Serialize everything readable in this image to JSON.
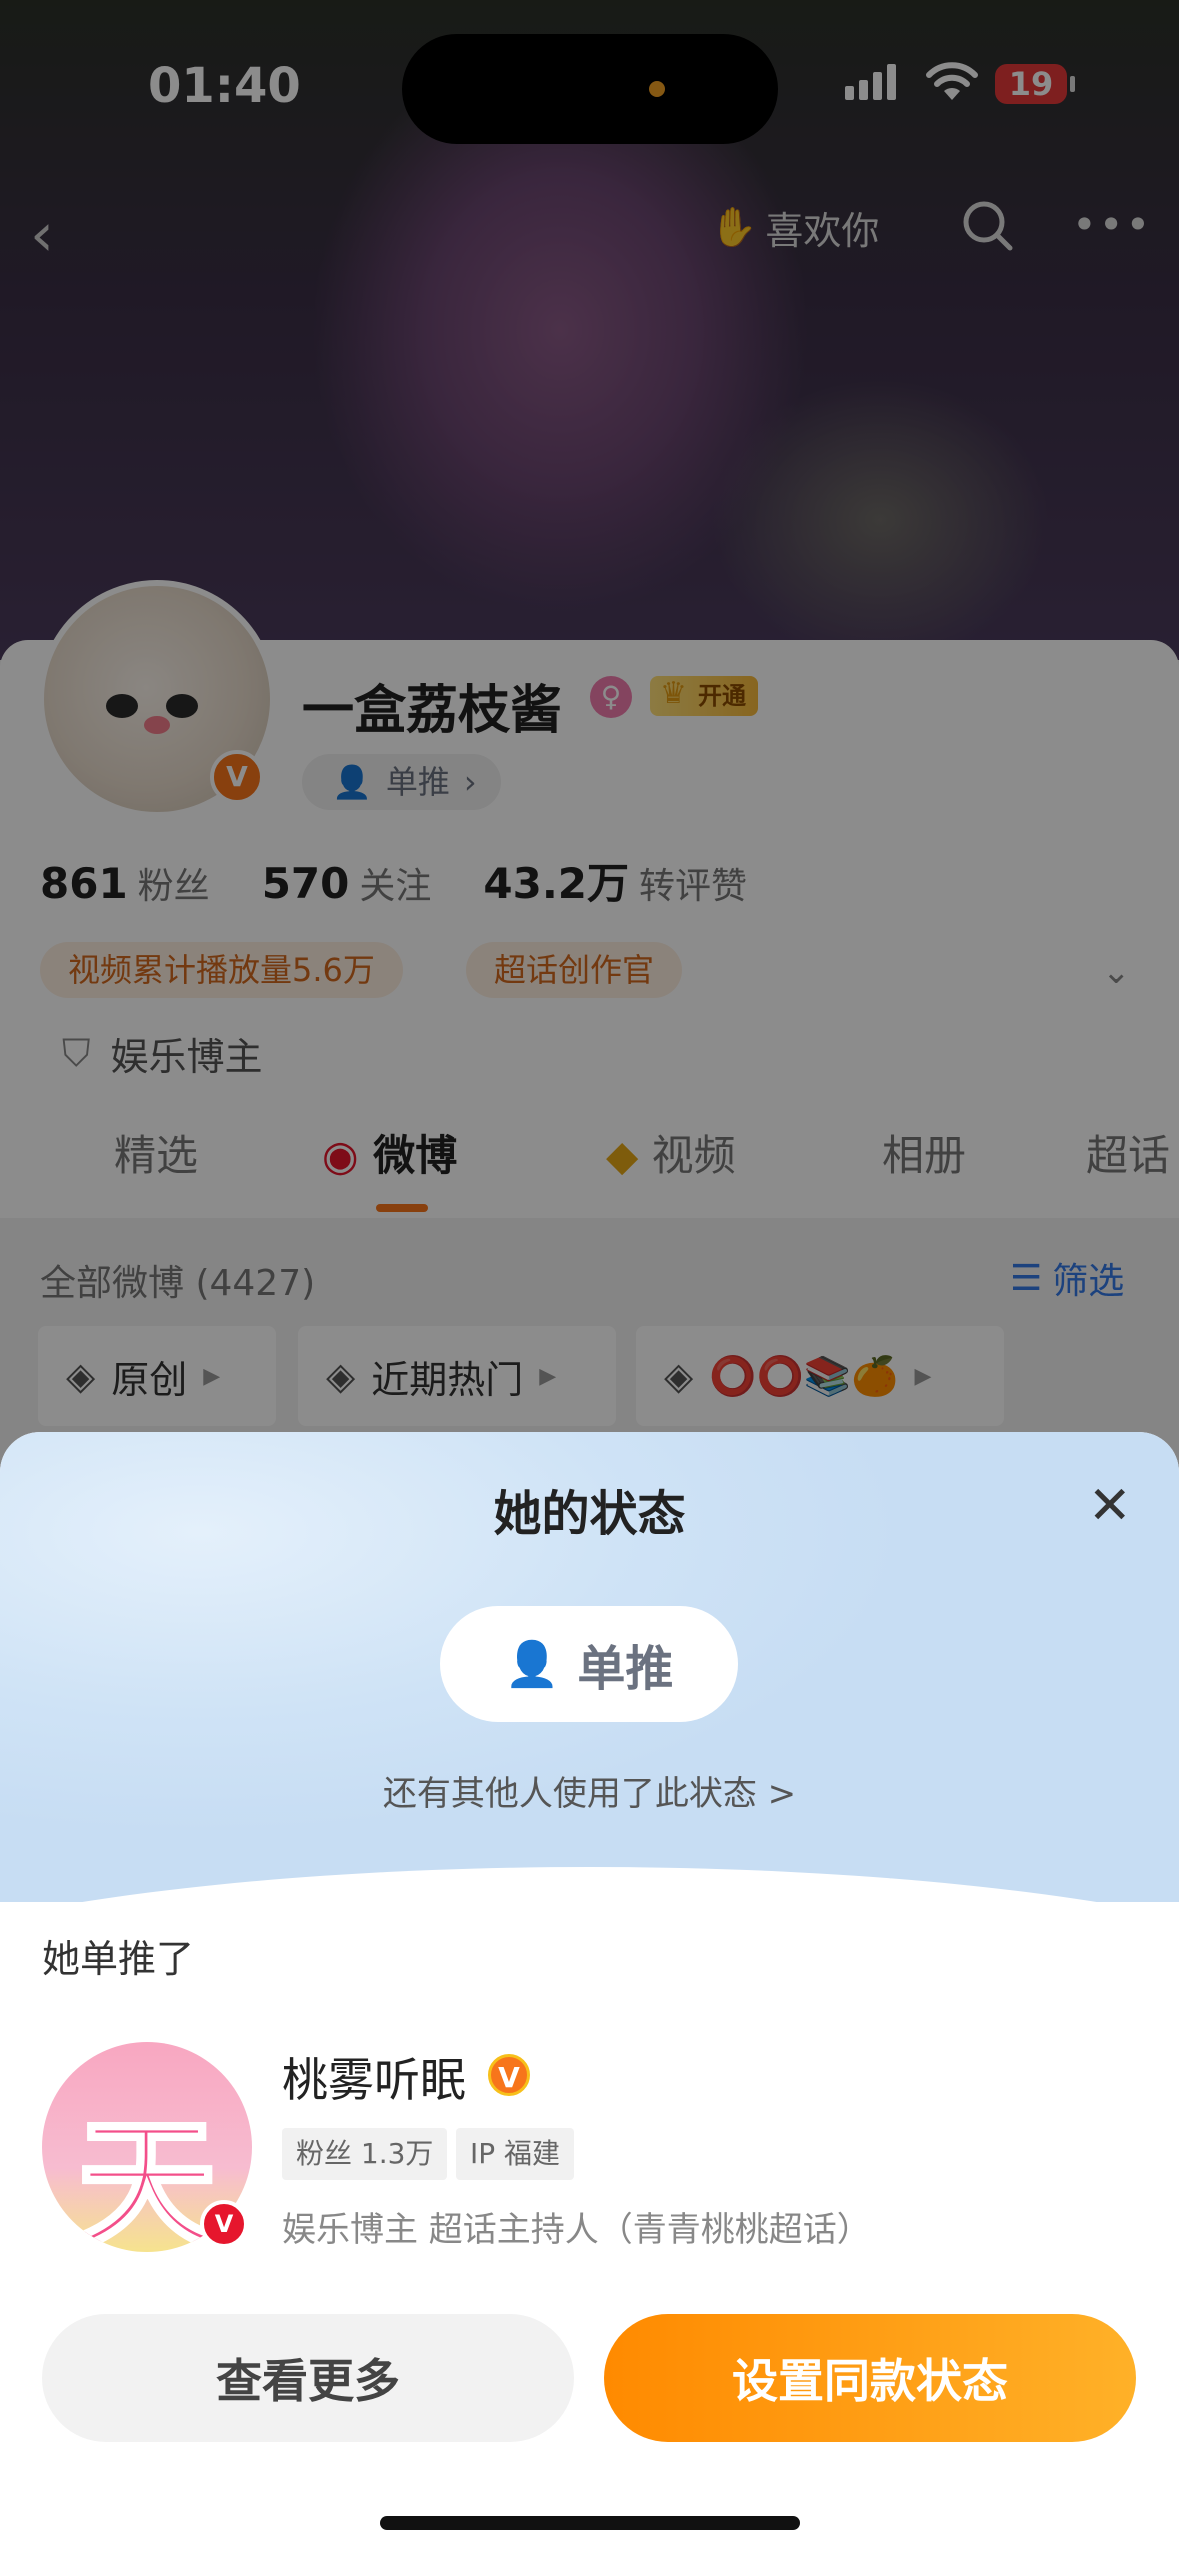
{
  "status_bar": {
    "time": "01:40",
    "battery": "19"
  },
  "nav": {
    "like_label": "喜欢你"
  },
  "profile": {
    "name": "一盒荔枝酱",
    "vip_label": "开通",
    "status_pill": "单推",
    "stats": [
      {
        "num": "861",
        "label": "粉丝"
      },
      {
        "num": "570",
        "label": "关注"
      },
      {
        "num": "43.2万",
        "label": "转评赞"
      }
    ],
    "tags": [
      "视频累计播放量5.6万",
      "超话创作官"
    ],
    "role": "娱乐博主"
  },
  "tabs": [
    "精选",
    "微博",
    "视频",
    "相册",
    "超话"
  ],
  "feed": {
    "count_label": "全部微博 (4427)",
    "filter_label": "筛选",
    "chips": [
      "原创",
      "近期热门",
      "⭕⭕📚🍊"
    ]
  },
  "sheet": {
    "title": "她的状态",
    "status_label": "单推",
    "others_link": "还有其他人使用了此状态 >",
    "single_label": "她单推了",
    "fav": {
      "name": "桃雾听眠",
      "avatar_char": "天",
      "fans_tag": "粉丝 1.3万",
      "ip_tag": "IP 福建",
      "desc": "娱乐博主 超话主持人（青青桃桃超话）"
    },
    "btn_more": "查看更多",
    "btn_set": "设置同款状态"
  },
  "colors": {
    "accent": "#f7751b",
    "link": "#3478e5",
    "button_gradient_start": "#ff8a00"
  }
}
